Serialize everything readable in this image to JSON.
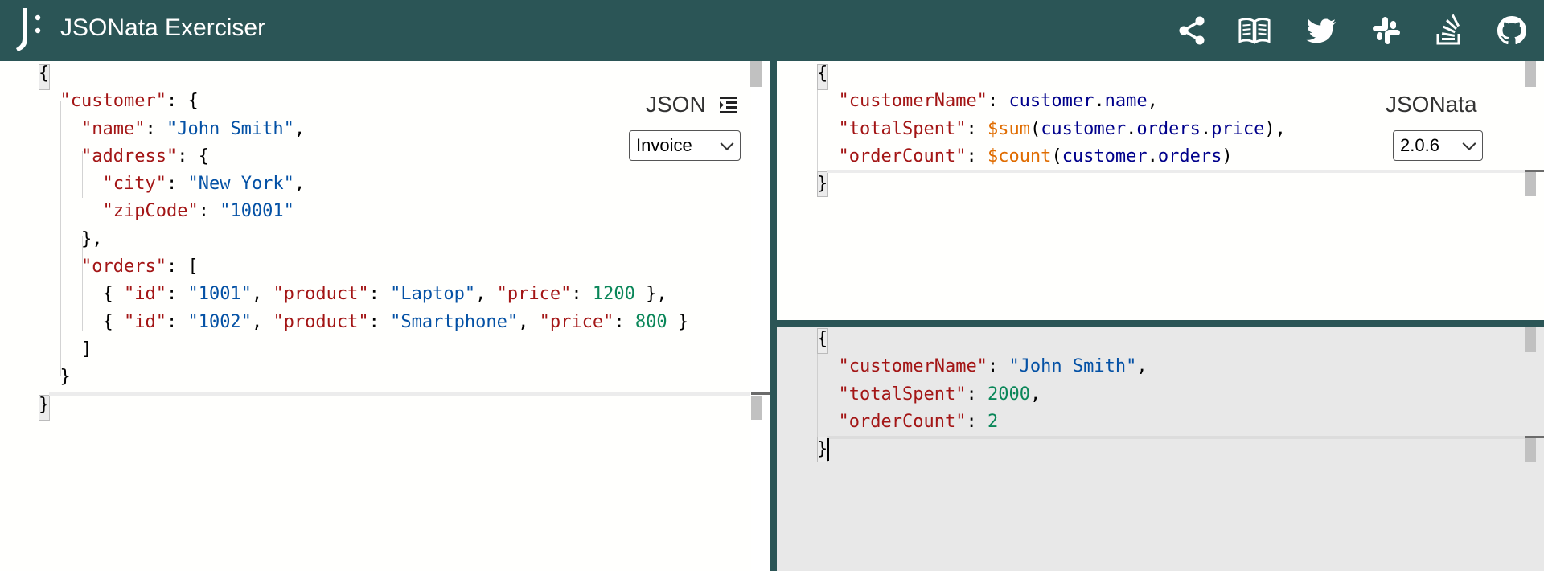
{
  "header": {
    "title": "JSONata Exerciser",
    "icons": [
      "share-icon",
      "book-icon",
      "twitter-icon",
      "slack-icon",
      "stackoverflow-icon",
      "github-icon"
    ]
  },
  "json_pane": {
    "label": "JSON",
    "sample_select": "Invoice",
    "lines": [
      [
        [
          "p",
          "{"
        ]
      ],
      [
        [
          "p",
          "  "
        ],
        [
          "k",
          "\"customer\""
        ],
        [
          "p",
          ": {"
        ]
      ],
      [
        [
          "p",
          "    "
        ],
        [
          "k",
          "\"name\""
        ],
        [
          "p",
          ": "
        ],
        [
          "s",
          "\"John Smith\""
        ],
        [
          "p",
          ","
        ]
      ],
      [
        [
          "p",
          "    "
        ],
        [
          "k",
          "\"address\""
        ],
        [
          "p",
          ": {"
        ]
      ],
      [
        [
          "p",
          "      "
        ],
        [
          "k",
          "\"city\""
        ],
        [
          "p",
          ": "
        ],
        [
          "s",
          "\"New York\""
        ],
        [
          "p",
          ","
        ]
      ],
      [
        [
          "p",
          "      "
        ],
        [
          "k",
          "\"zipCode\""
        ],
        [
          "p",
          ": "
        ],
        [
          "s",
          "\"10001\""
        ]
      ],
      [
        [
          "p",
          "    },"
        ]
      ],
      [
        [
          "p",
          "    "
        ],
        [
          "k",
          "\"orders\""
        ],
        [
          "p",
          ": ["
        ]
      ],
      [
        [
          "p",
          "      { "
        ],
        [
          "k",
          "\"id\""
        ],
        [
          "p",
          ": "
        ],
        [
          "s",
          "\"1001\""
        ],
        [
          "p",
          ", "
        ],
        [
          "k",
          "\"product\""
        ],
        [
          "p",
          ": "
        ],
        [
          "s",
          "\"Laptop\""
        ],
        [
          "p",
          ", "
        ],
        [
          "k",
          "\"price\""
        ],
        [
          "p",
          ": "
        ],
        [
          "n",
          "1200"
        ],
        [
          "p",
          " },"
        ]
      ],
      [
        [
          "p",
          "      { "
        ],
        [
          "k",
          "\"id\""
        ],
        [
          "p",
          ": "
        ],
        [
          "s",
          "\"1002\""
        ],
        [
          "p",
          ", "
        ],
        [
          "k",
          "\"product\""
        ],
        [
          "p",
          ": "
        ],
        [
          "s",
          "\"Smartphone\""
        ],
        [
          "p",
          ", "
        ],
        [
          "k",
          "\"price\""
        ],
        [
          "p",
          ": "
        ],
        [
          "n",
          "800"
        ],
        [
          "p",
          " }"
        ]
      ],
      [
        [
          "p",
          "    ]"
        ]
      ],
      [
        [
          "p",
          "  }"
        ]
      ],
      [
        [
          "p",
          "}"
        ]
      ]
    ]
  },
  "expr_pane": {
    "label": "JSONata",
    "version_select": "2.0.6",
    "lines": [
      [
        [
          "p",
          "{"
        ]
      ],
      [
        [
          "p",
          "  "
        ],
        [
          "k",
          "\"customerName\""
        ],
        [
          "p",
          ": "
        ],
        [
          "id",
          "customer"
        ],
        [
          "p",
          "."
        ],
        [
          "id",
          "name"
        ],
        [
          "p",
          ","
        ]
      ],
      [
        [
          "p",
          "  "
        ],
        [
          "k",
          "\"totalSpent\""
        ],
        [
          "p",
          ": "
        ],
        [
          "fn",
          "$sum"
        ],
        [
          "p",
          "("
        ],
        [
          "id",
          "customer"
        ],
        [
          "p",
          "."
        ],
        [
          "id",
          "orders"
        ],
        [
          "p",
          "."
        ],
        [
          "id",
          "price"
        ],
        [
          "p",
          "),"
        ]
      ],
      [
        [
          "p",
          "  "
        ],
        [
          "k",
          "\"orderCount\""
        ],
        [
          "p",
          ": "
        ],
        [
          "fn",
          "$count"
        ],
        [
          "p",
          "("
        ],
        [
          "id",
          "customer"
        ],
        [
          "p",
          "."
        ],
        [
          "id",
          "orders"
        ],
        [
          "p",
          ")"
        ]
      ],
      [
        [
          "p",
          "}"
        ]
      ]
    ]
  },
  "result_pane": {
    "lines": [
      [
        [
          "p",
          "{"
        ]
      ],
      [
        [
          "p",
          "  "
        ],
        [
          "k",
          "\"customerName\""
        ],
        [
          "p",
          ": "
        ],
        [
          "s",
          "\"John Smith\""
        ],
        [
          "p",
          ","
        ]
      ],
      [
        [
          "p",
          "  "
        ],
        [
          "k",
          "\"totalSpent\""
        ],
        [
          "p",
          ": "
        ],
        [
          "n",
          "2000"
        ],
        [
          "p",
          ","
        ]
      ],
      [
        [
          "p",
          "  "
        ],
        [
          "k",
          "\"orderCount\""
        ],
        [
          "p",
          ": "
        ],
        [
          "n",
          "2"
        ]
      ],
      [
        [
          "p",
          "}"
        ]
      ]
    ]
  }
}
